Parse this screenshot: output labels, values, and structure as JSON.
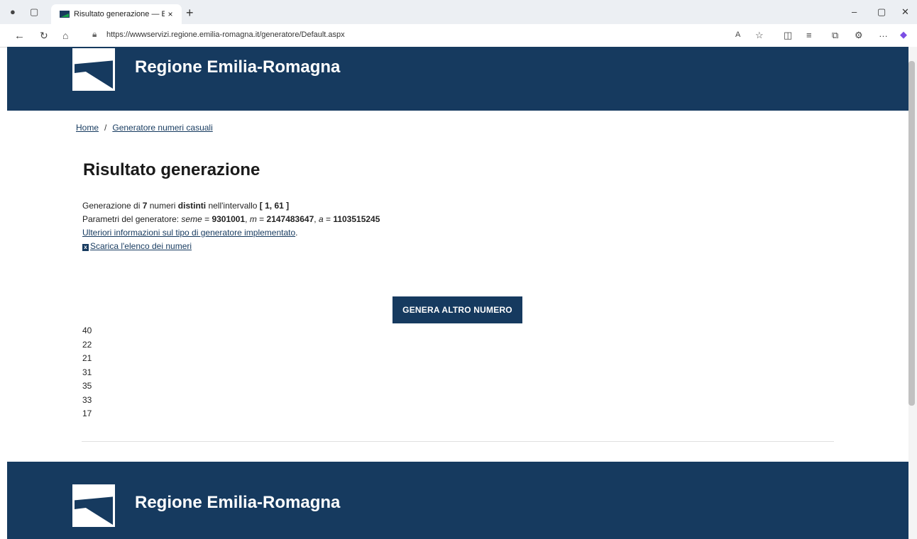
{
  "browser": {
    "tab_title": "Risultato generazione — E-R Il po",
    "tab_close": "×",
    "new_tab": "+",
    "url": "https://wwwservizi.regione.emilia-romagna.it/generatore/Default.aspx",
    "window_min": "–",
    "window_max": "▢",
    "window_close": "✕"
  },
  "header": {
    "brand": "Regione Emilia-Romagna"
  },
  "breadcrumb": {
    "home": "Home",
    "separator": "/",
    "current": "Generatore numeri casuali"
  },
  "main": {
    "title": "Risultato generazione",
    "line1_prefix": "Generazione di ",
    "count": "7",
    "line1_mid": " numeri ",
    "distinct": "distinti",
    "line1_after": " nell'intervallo ",
    "interval": "[ 1, 61 ]",
    "params_prefix": "Parametri del generatore: ",
    "seed_label": "seme",
    "seed_value": "9301001",
    "m_label": "m",
    "m_value": "2147483647",
    "a_label": "a",
    "a_value": "1103515245",
    "more_info_link": "Ulteriori informazioni sul tipo di generatore implementato",
    "download_icon": "x",
    "download_link": "Scarica l'elenco dei numeri",
    "generate_button": "GENERA ALTRO NUMERO",
    "numbers": [
      "40",
      "22",
      "21",
      "31",
      "35",
      "33",
      "17"
    ]
  },
  "footer": {
    "brand": "Regione Emilia-Romagna"
  },
  "colors": {
    "primary": "#163a5f"
  }
}
